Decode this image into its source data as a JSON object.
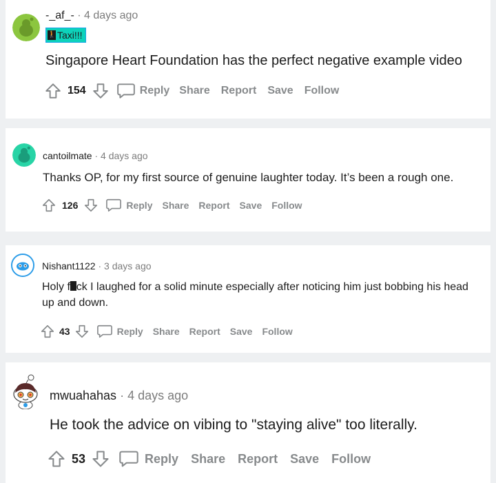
{
  "comments": [
    {
      "username": "-_af_-",
      "time": "4 days ago",
      "flair": "Taxi!!!",
      "text": "Singapore Heart Foundation has the perfect negative example video",
      "score": "154",
      "avatar_color": "#8cc63f"
    },
    {
      "username": "cantoilmate",
      "time": "4 days ago",
      "text": "Thanks OP, for my first source of genuine laughter today. It’s been a rough one.",
      "score": "126",
      "avatar_color": "#28d4a6"
    },
    {
      "username": "Nishant1122",
      "time": "3 days ago",
      "text_before": "Holy f",
      "text_after": "ck I laughed for a solid minute especially after noticing him just bobbing his head up and down.",
      "score": "43",
      "avatar_color": "#ffffff"
    },
    {
      "username": "mwuahahas",
      "time": "4 days ago",
      "text": "He took the advice on vibing to \"staying alive\" too literally.",
      "score": "53",
      "avatar_color": "#ffffff"
    }
  ],
  "actions": {
    "reply": "Reply",
    "share": "Share",
    "report": "Report",
    "save": "Save",
    "follow": "Follow"
  },
  "separator": "·"
}
